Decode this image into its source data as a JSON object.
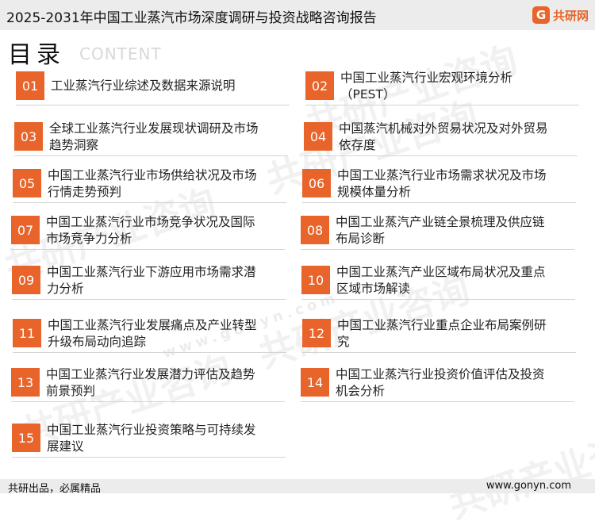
{
  "header": {
    "title": "2025-2031年中国工业蒸汽市场深度调研与投资战略咨询报告",
    "brand_mark": "G",
    "brand_name": "共研网"
  },
  "heading": {
    "main": "目录",
    "sub": "CONTENT"
  },
  "watermark": {
    "text": "共研产业咨询",
    "site": "www.gonyn.com"
  },
  "toc": [
    {
      "number": "01",
      "text": "工业蒸汽行业综述及数据来源说明"
    },
    {
      "number": "02",
      "text": "中国工业蒸汽行业宏观环境分析（PEST）"
    },
    {
      "number": "03",
      "text": "全球工业蒸汽行业发展现状调研及市场趋势洞察"
    },
    {
      "number": "04",
      "text": "中国蒸汽机械对外贸易状况及对外贸易依存度"
    },
    {
      "number": "05",
      "text": "中国工业蒸汽行业市场供给状况及市场行情走势预判"
    },
    {
      "number": "06",
      "text": "中国工业蒸汽行业市场需求状况及市场规模体量分析"
    },
    {
      "number": "07",
      "text": "中国工业蒸汽行业市场竞争状况及国际市场竞争力分析"
    },
    {
      "number": "08",
      "text": "中国工业蒸汽产业链全景梳理及供应链布局诊断"
    },
    {
      "number": "09",
      "text": "中国工业蒸汽行业下游应用市场需求潜力分析"
    },
    {
      "number": "10",
      "text": "中国工业蒸汽产业区域布局状况及重点区域市场解读"
    },
    {
      "number": "11",
      "text": "中国工业蒸汽行业发展痛点及产业转型升级布局动向追踪"
    },
    {
      "number": "12",
      "text": "中国工业蒸汽行业重点企业布局案例研究"
    },
    {
      "number": "13",
      "text": "中国工业蒸汽行业发展潜力评估及趋势前景预判"
    },
    {
      "number": "14",
      "text": "中国工业蒸汽行业投资价值评估及投资机会分析"
    },
    {
      "number": "15",
      "text": "中国工业蒸汽行业投资策略与可持续发展建议"
    }
  ],
  "footer": {
    "slogan": "共研出品，必属精品",
    "site": "www.gonyn.com"
  },
  "colors": {
    "accent": "#e8642a",
    "bar_gray": "#ececec"
  }
}
